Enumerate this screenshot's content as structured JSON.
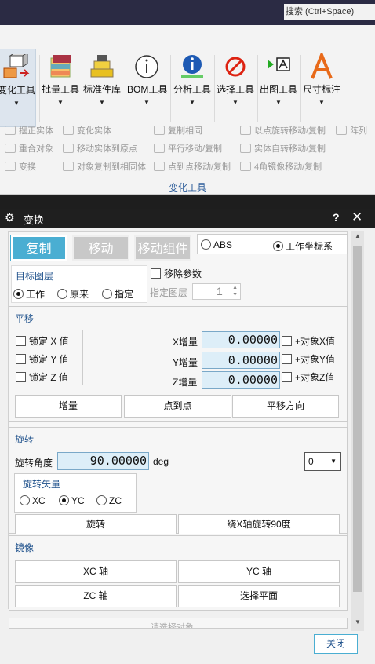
{
  "search": {
    "placeholder": "搜索 (Ctrl+Space)"
  },
  "ribbon": {
    "tools": [
      {
        "label": "变化工具",
        "icon": "transform-icon"
      },
      {
        "label": "批量工具",
        "icon": "batch-icon"
      },
      {
        "label": "标准件库",
        "icon": "standard-parts-icon"
      },
      {
        "label": "BOM工具",
        "icon": "info-circle-icon"
      },
      {
        "label": "分析工具",
        "icon": "analysis-icon"
      },
      {
        "label": "选择工具",
        "icon": "no-entry-icon"
      },
      {
        "label": "出图工具",
        "icon": "drawing-icon"
      },
      {
        "label": "尺寸标注",
        "icon": "dimension-icon"
      }
    ],
    "commands": [
      {
        "label": "摆正实体",
        "icon": "align-icon"
      },
      {
        "label": "变化实体",
        "icon": "transform-small-icon"
      },
      {
        "label": "复制相同",
        "icon": "copy-icon"
      },
      {
        "label": "以点旋转移动/复制",
        "icon": "rotate-point-icon"
      },
      {
        "label": "阵列",
        "icon": "array-icon"
      },
      {
        "label": "重合对象",
        "icon": "overlap-icon"
      },
      {
        "label": "移动实体到原点",
        "icon": "move-origin-icon"
      },
      {
        "label": "平行移动/复制",
        "icon": "parallel-move-icon"
      },
      {
        "label": "实体自转移动/复制",
        "icon": "self-rotate-icon"
      },
      {
        "label": "变换",
        "icon": "transform-small-icon"
      },
      {
        "label": "对象复制到相同体",
        "icon": "copy-to-body-icon"
      },
      {
        "label": "点到点移动/复制",
        "icon": "point-to-point-icon"
      },
      {
        "label": "4角镜像移动/复制",
        "icon": "mirror-icon"
      }
    ],
    "group_label": "变化工具"
  },
  "dialog": {
    "title": "变换",
    "help": "?",
    "close": "✕",
    "modes": [
      "复制",
      "移动",
      "移动组件"
    ],
    "coord": {
      "abs": "ABS",
      "work": "工作坐标系",
      "selected": "work"
    },
    "target_layer": {
      "title": "目标图层",
      "options": [
        "工作",
        "原来",
        "指定"
      ],
      "selected": "工作"
    },
    "remove_params": "移除参数",
    "specify_layer": {
      "label": "指定图层",
      "value": "1"
    },
    "translate": {
      "title": "平移",
      "locks": [
        "锁定 X 值",
        "锁定 Y 值",
        "锁定 Z 值"
      ],
      "increments": [
        {
          "label": "X增量",
          "value": "0.00000",
          "obj": "+对象X值"
        },
        {
          "label": "Y增量",
          "value": "0.00000",
          "obj": "+对象Y值"
        },
        {
          "label": "Z增量",
          "value": "0.00000",
          "obj": "+对象Z值"
        }
      ],
      "buttons": [
        "增量",
        "点到点",
        "平移方向"
      ]
    },
    "rotate": {
      "title": "旋转",
      "angle_label": "旋转角度",
      "angle_value": "90.00000",
      "unit": "deg",
      "dropdown": "0",
      "vector_title": "旋转矢量",
      "vectors": [
        "XC",
        "YC",
        "ZC"
      ],
      "vector_selected": "YC",
      "buttons": [
        "旋转",
        "绕X轴旋转90度"
      ]
    },
    "mirror": {
      "title": "镜像",
      "buttons": [
        "XC 轴",
        "YC 轴",
        "ZC 轴",
        "选择平面"
      ]
    },
    "partial_text": "请选择对象",
    "close_button": "关闭"
  },
  "colors": {
    "accent": "#4aaed2",
    "title_bg": "#1f1f1f",
    "section_title": "#1c4f8a",
    "numbox_bg": "#ddeef8"
  }
}
